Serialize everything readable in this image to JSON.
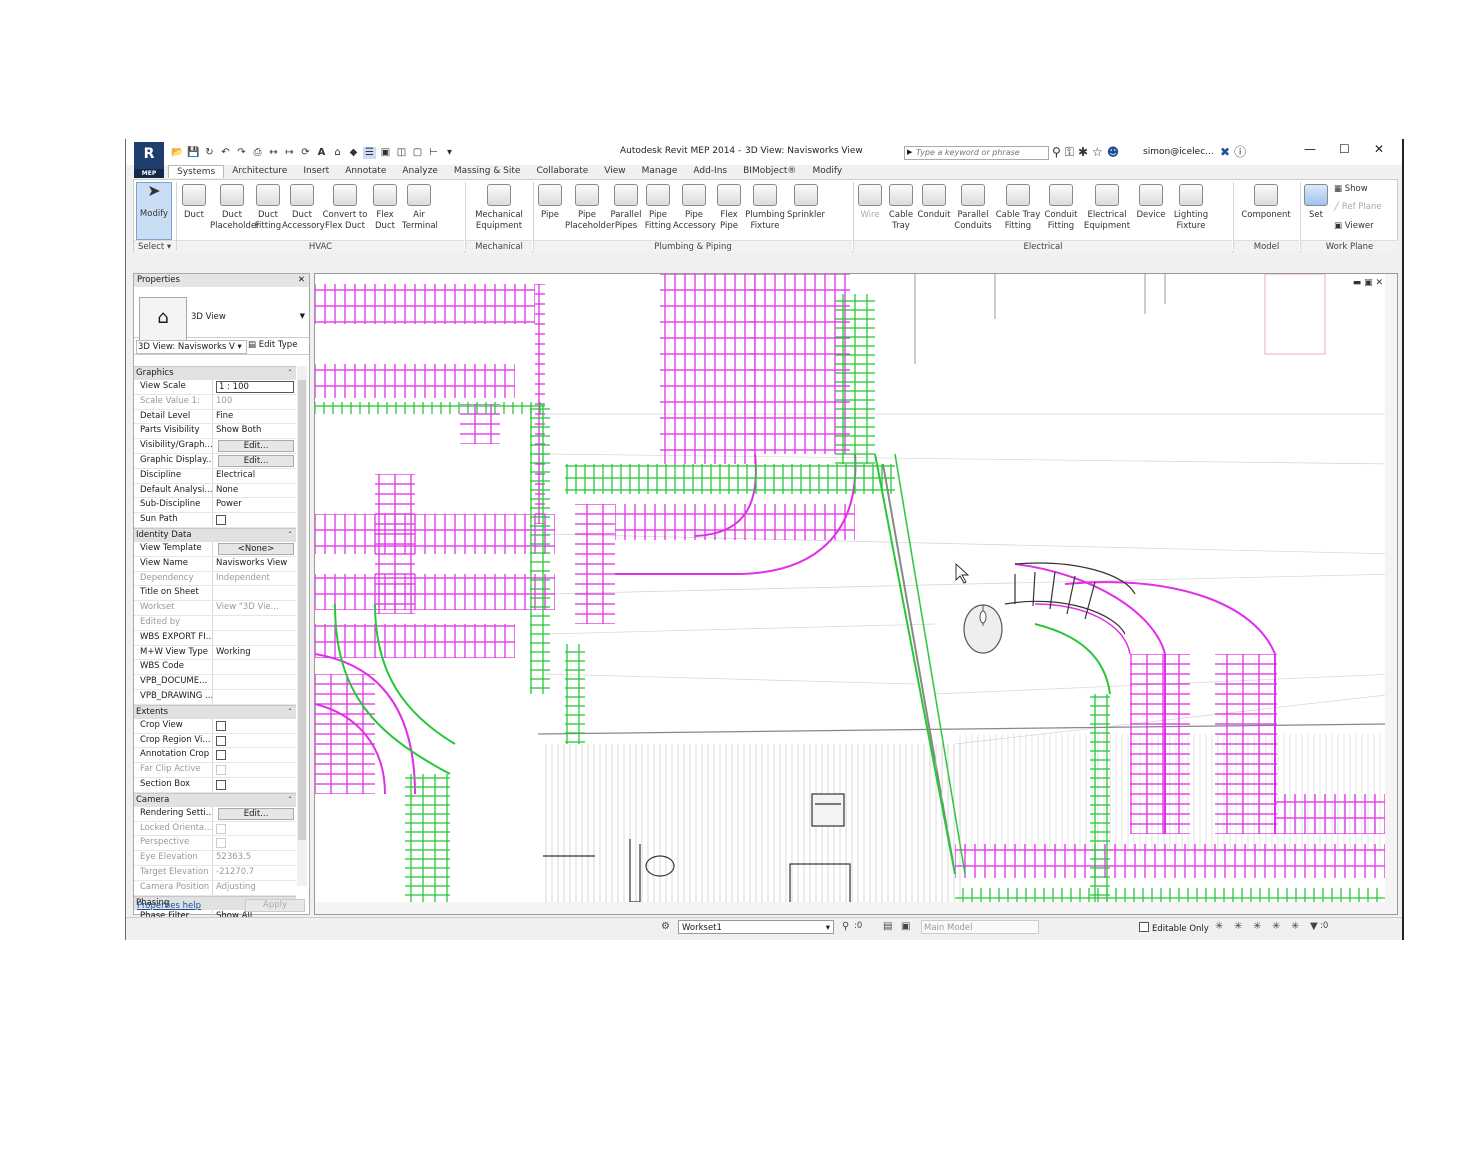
{
  "titlebar": {
    "app_name": "Autodesk Revit MEP 2014 -",
    "view_name": "3D View: Navisworks View",
    "search_placeholder": "Type a keyword or phrase",
    "user": "simon@icelec...",
    "app_menu_label": "MEP"
  },
  "tabs": [
    "Systems",
    "Architecture",
    "Insert",
    "Annotate",
    "Analyze",
    "Massing & Site",
    "Collaborate",
    "View",
    "Manage",
    "Add-Ins",
    "BIMobject®",
    "Modify"
  ],
  "ribbon": {
    "modify": "Modify",
    "select": "Select",
    "hvac": {
      "label": "HVAC",
      "buttons": [
        [
          "Duct",
          ""
        ],
        [
          "Duct",
          "Placeholder"
        ],
        [
          "Duct",
          "Fitting"
        ],
        [
          "Duct",
          "Accessory"
        ],
        [
          "Convert to",
          "Flex Duct"
        ],
        [
          "Flex",
          "Duct"
        ],
        [
          "Air",
          "Terminal"
        ]
      ]
    },
    "mechanical": {
      "label": "Mechanical",
      "buttons": [
        [
          "Mechanical",
          "Equipment"
        ]
      ]
    },
    "plumbing": {
      "label": "Plumbing & Piping",
      "buttons": [
        [
          "Pipe",
          ""
        ],
        [
          "Pipe",
          "Placeholder"
        ],
        [
          "Parallel",
          "Pipes"
        ],
        [
          "Pipe",
          "Fitting"
        ],
        [
          "Pipe",
          "Accessory"
        ],
        [
          "Flex",
          "Pipe"
        ],
        [
          "Plumbing",
          "Fixture"
        ],
        [
          "Sprinkler",
          ""
        ]
      ]
    },
    "electrical": {
      "label": "Electrical",
      "buttons": [
        [
          "Wire",
          ""
        ],
        [
          "Cable",
          "Tray"
        ],
        [
          "Conduit",
          ""
        ],
        [
          "Parallel",
          "Conduits"
        ],
        [
          "Cable Tray",
          "Fitting"
        ],
        [
          "Conduit",
          "Fitting"
        ],
        [
          "Electrical",
          "Equipment"
        ],
        [
          "Device",
          ""
        ],
        [
          "Lighting",
          "Fixture"
        ]
      ]
    },
    "model": {
      "label": "Model",
      "buttons": [
        [
          "Component",
          ""
        ]
      ]
    },
    "workplane": {
      "label": "Work Plane",
      "set": "Set",
      "show": "Show",
      "ref_plane": "Ref Plane",
      "viewer": "Viewer"
    }
  },
  "properties": {
    "title": "Properties",
    "type_name": "3D View",
    "instance": "3D View: Navisworks V",
    "edit_type": "Edit Type",
    "groups": [
      {
        "name": "Graphics",
        "rows": [
          {
            "k": "View Scale",
            "v": "1 : 100",
            "kind": "input"
          },
          {
            "k": "Scale Value    1:",
            "v": "100",
            "dim": true
          },
          {
            "k": "Detail Level",
            "v": "Fine"
          },
          {
            "k": "Parts Visibility",
            "v": "Show Both"
          },
          {
            "k": "Visibility/Graph...",
            "v": "Edit...",
            "kind": "button"
          },
          {
            "k": "Graphic Display...",
            "v": "Edit...",
            "kind": "button"
          },
          {
            "k": "Discipline",
            "v": "Electrical"
          },
          {
            "k": "Default Analysi...",
            "v": "None"
          },
          {
            "k": "Sub-Discipline",
            "v": "Power"
          },
          {
            "k": "Sun Path",
            "v": "",
            "kind": "check"
          }
        ]
      },
      {
        "name": "Identity Data",
        "rows": [
          {
            "k": "View Template",
            "v": "<None>",
            "kind": "button"
          },
          {
            "k": "View Name",
            "v": "Navisworks View"
          },
          {
            "k": "Dependency",
            "v": "Independent",
            "dim": true
          },
          {
            "k": "Title on Sheet",
            "v": ""
          },
          {
            "k": "Workset",
            "v": "View \"3D Vie...",
            "dim": true
          },
          {
            "k": "Edited by",
            "v": "",
            "dim": true
          },
          {
            "k": "WBS EXPORT FI...",
            "v": ""
          },
          {
            "k": "M+W View Type",
            "v": "Working"
          },
          {
            "k": "WBS Code",
            "v": ""
          },
          {
            "k": "VPB_DOCUME...",
            "v": ""
          },
          {
            "k": "VPB_DRAWING ...",
            "v": ""
          }
        ]
      },
      {
        "name": "Extents",
        "rows": [
          {
            "k": "Crop View",
            "v": "",
            "kind": "check"
          },
          {
            "k": "Crop Region Vi...",
            "v": "",
            "kind": "check"
          },
          {
            "k": "Annotation Crop",
            "v": "",
            "kind": "check"
          },
          {
            "k": "Far Clip Active",
            "v": "",
            "kind": "check",
            "dim": true
          },
          {
            "k": "Section Box",
            "v": "",
            "kind": "check"
          }
        ]
      },
      {
        "name": "Camera",
        "rows": [
          {
            "k": "Rendering Setti...",
            "v": "Edit...",
            "kind": "button"
          },
          {
            "k": "Locked Orienta...",
            "v": "",
            "kind": "check",
            "dim": true
          },
          {
            "k": "Perspective",
            "v": "",
            "kind": "check",
            "dim": true
          },
          {
            "k": "Eye Elevation",
            "v": "52363.5",
            "dim": true
          },
          {
            "k": "Target Elevation",
            "v": "-21270.7",
            "dim": true
          },
          {
            "k": "Camera Position",
            "v": "Adjusting",
            "dim": true
          }
        ]
      },
      {
        "name": "Phasing",
        "rows": [
          {
            "k": "Phase Filter",
            "v": "Show All"
          }
        ]
      }
    ],
    "help": "Properties help",
    "apply": "Apply"
  },
  "statusbar": {
    "workset": "Workset1",
    "workset_count": ":0",
    "main_model": "Main Model",
    "editable_only": "Editable Only",
    "filter_count": ":0"
  },
  "colors": {
    "magenta": "#e12ee8",
    "green": "#29c639",
    "ribbon_active": "#c9def5"
  }
}
